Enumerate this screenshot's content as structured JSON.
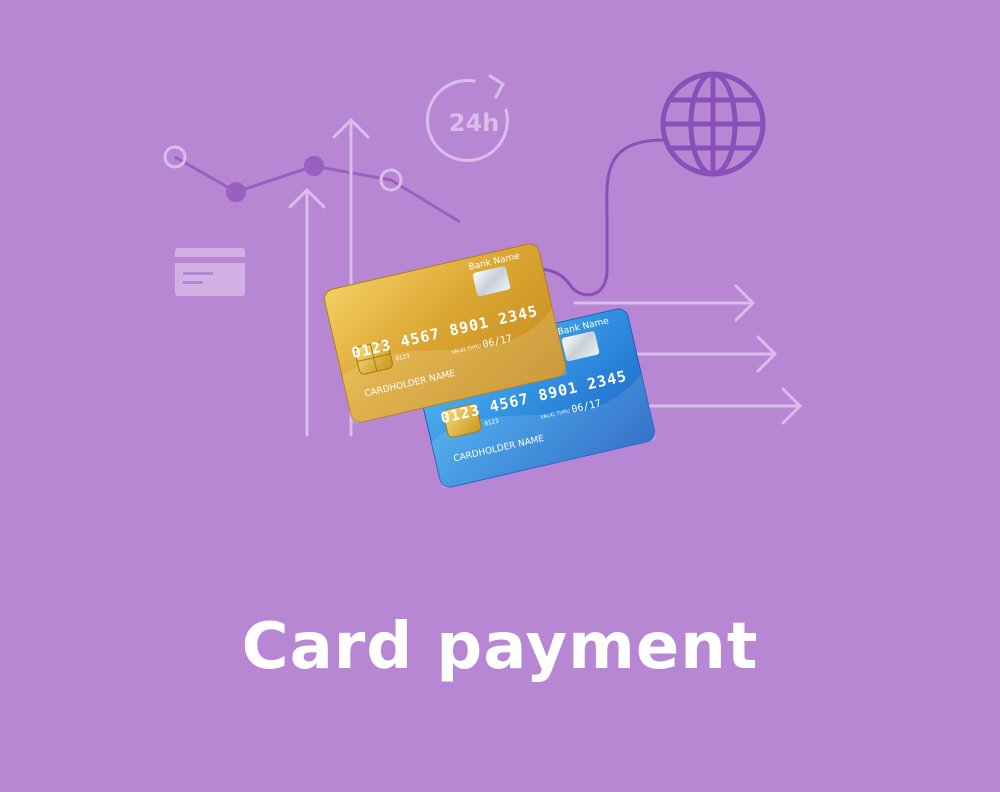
{
  "title": "Card payment",
  "clock_label": "24h",
  "cards": {
    "gold": {
      "bank_name": "Bank Name",
      "number": "0123 4567 8901 2345",
      "expiry": "06/17",
      "expiry_prefix": "VALID THRU",
      "holder": "CARDHOLDER NAME",
      "small_code": "0123"
    },
    "blue": {
      "bank_name": "Bank Name",
      "number": "0123 4567 8901 2345",
      "expiry": "06/17",
      "expiry_prefix": "VALID THRU",
      "holder": "CARDHOLDER NAME",
      "small_code": "0123"
    }
  },
  "colors": {
    "background": "#b887d4",
    "line_light": "#d9bdea",
    "line_dark": "#9a5fc0",
    "globe": "#8a4fb8",
    "title": "#ffffff",
    "gold_card": "#d9a62e",
    "blue_card": "#2f8fe0"
  },
  "icons": [
    "line-graph-icon",
    "up-arrow-icon",
    "clock-24h-icon",
    "globe-icon",
    "card-icon",
    "right-arrow-icon"
  ]
}
